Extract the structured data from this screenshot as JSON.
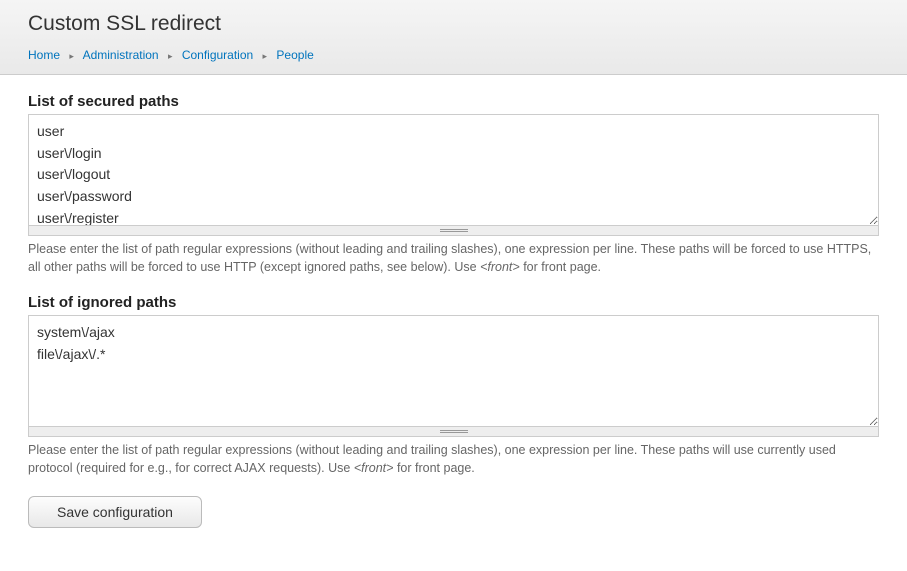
{
  "page": {
    "title": "Custom SSL redirect"
  },
  "breadcrumb": {
    "items": [
      {
        "label": "Home"
      },
      {
        "label": "Administration"
      },
      {
        "label": "Configuration"
      },
      {
        "label": "People"
      }
    ],
    "separator": "▸"
  },
  "form": {
    "secured": {
      "label": "List of secured paths",
      "value": "user\nuser\\/login\nuser\\/logout\nuser\\/password\nuser\\/register",
      "description_pre": "Please enter the list of path regular expressions (without leading and trailing slashes), one expression per line. These paths will be forced to use HTTPS, all other paths will be forced to use HTTP (except ignored paths, see below). Use ",
      "description_em": "<front>",
      "description_post": " for front page."
    },
    "ignored": {
      "label": "List of ignored paths",
      "value": "system\\/ajax\nfile\\/ajax\\/.*",
      "description_pre": "Please enter the list of path regular expressions (without leading and trailing slashes), one expression per line. These paths will use currently used protocol (required for e.g., for correct AJAX requests). Use ",
      "description_em": "<front>",
      "description_post": " for front page."
    },
    "submit_label": "Save configuration"
  }
}
